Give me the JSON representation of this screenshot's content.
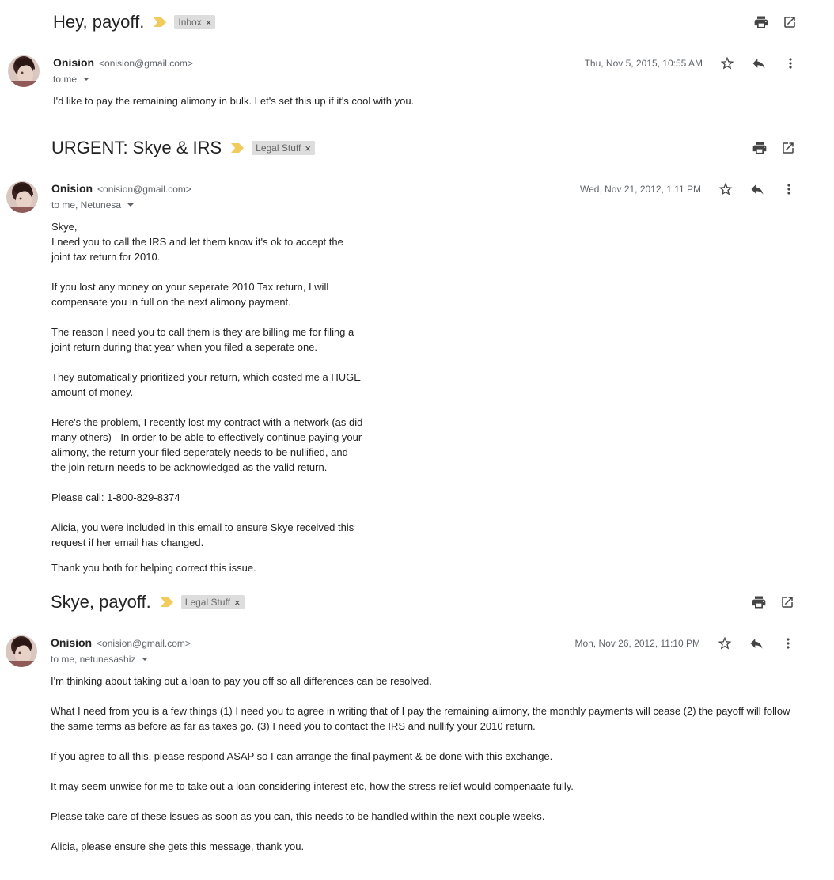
{
  "threads": [
    {
      "subject": "Hey, payoff.",
      "label": "Inbox",
      "sender_name": "Onision",
      "sender_email": "<onision@gmail.com>",
      "to": "to me",
      "date": "Thu, Nov 5, 2015, 10:55 AM",
      "body": [
        "I'd like to pay the remaining alimony in bulk. Let's set this up if it's cool with you."
      ]
    },
    {
      "subject": "URGENT: Skye & IRS",
      "label": "Legal Stuff",
      "sender_name": "Onision",
      "sender_email": "<onision@gmail.com>",
      "to": "to me, Netunesa",
      "date": "Wed, Nov 21, 2012, 1:11 PM",
      "body": [
        "Skye,\nI need you to call the IRS and let them know it's ok to accept the\njoint tax return for 2010.",
        "If you lost any money on your seperate 2010 Tax return, I will\ncompensate you in full on the next alimony payment.",
        "The reason I need you to call them is they are billing me for filing a\njoint return during that year when you filed a seperate one.",
        "They automatically prioritized your return, which costed me a HUGE\namount of money.",
        "Here's the problem, I recently lost my contract with a network (as did\nmany others) - In order to be able to effectively continue paying your\nalimony, the return your filed seperately needs to be nullified, and\nthe join return needs to be acknowledged as the valid return.",
        "Please call: 1-800-829-8374",
        "Alicia, you were included in this email to ensure Skye received this\nrequest if her email has changed.",
        "Thank you both for helping correct this issue."
      ]
    },
    {
      "subject": "Skye, payoff.",
      "label": "Legal Stuff",
      "sender_name": "Onision",
      "sender_email": "<onision@gmail.com>",
      "to": "to me, netunesashiz",
      "date": "Mon, Nov 26, 2012, 11:10 PM",
      "body": [
        "I'm thinking about taking out a loan to pay you off so all differences can be resolved.",
        "What I need from you is a few things (1) I need you to agree in writing that of I pay the remaining alimony, the monthly payments will cease (2) the payoff will follow\nthe same terms as before as far as taxes go. (3) I need you to contact the IRS and nullify your 2010 return.",
        "If you agree to all this, please respond ASAP so I can arrange the final payment & be done with this exchange.",
        "It may seem unwise for me to take out a loan considering interest etc, how the stress relief would compenaate fully.",
        "Please take care of these issues as soon as you can, this needs to be handled within the next couple weeks.",
        "Alicia, please ensure she gets this message, thank you."
      ]
    }
  ],
  "icons": {
    "print": "print-icon",
    "open": "open-in-new-window-icon",
    "star": "star-icon",
    "reply": "reply-icon",
    "more": "more-vertical-icon",
    "importance": "importance-marker-icon"
  },
  "colors": {
    "importance": "#f2cb5d",
    "chip_bg": "#dddddd",
    "icon": "#444444"
  }
}
